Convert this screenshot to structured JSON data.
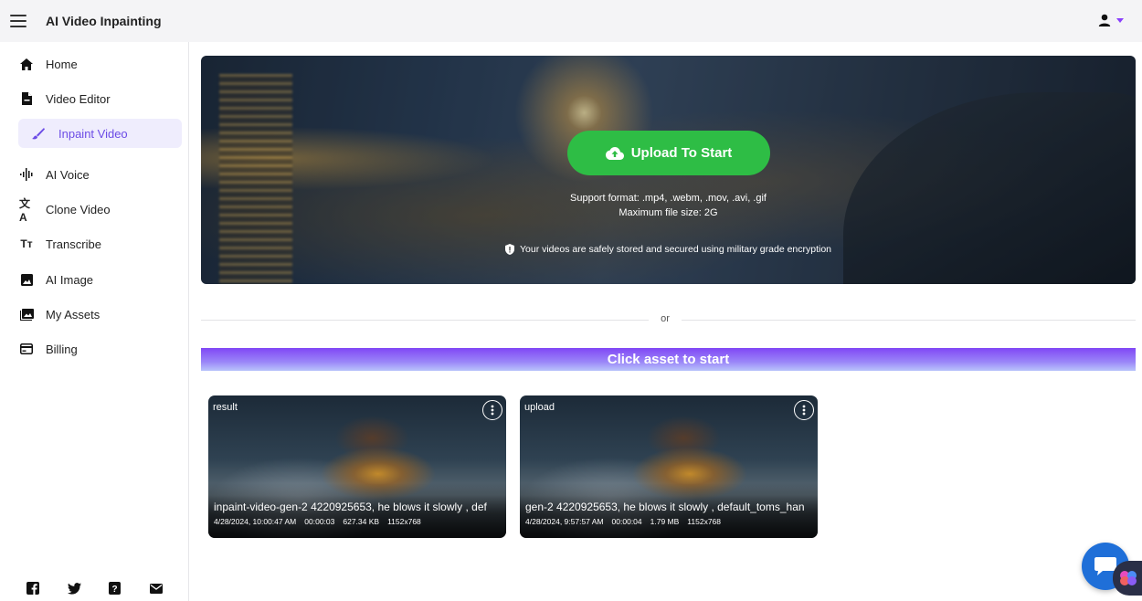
{
  "app": {
    "title": "AI Video Inpainting"
  },
  "sidebar": {
    "items": [
      {
        "label": "Home",
        "icon": "home-icon"
      },
      {
        "label": "Video Editor",
        "icon": "file-icon"
      },
      {
        "label": "Inpaint Video",
        "icon": "brush-icon",
        "active": true
      },
      {
        "label": "AI Voice",
        "icon": "waveform-icon"
      },
      {
        "label": "Clone Video",
        "icon": "translate-icon"
      },
      {
        "label": "Transcribe",
        "icon": "text-size-icon"
      },
      {
        "label": "AI Image",
        "icon": "image-icon"
      },
      {
        "label": "My Assets",
        "icon": "photo-library-icon"
      },
      {
        "label": "Billing",
        "icon": "credit-card-icon"
      }
    ],
    "social": [
      "facebook-icon",
      "twitter-icon",
      "help-icon",
      "mail-icon"
    ]
  },
  "hero": {
    "upload_label": "Upload To Start",
    "support_format": "Support format: .mp4, .webm, .mov, .avi, .gif",
    "max_size": "Maximum file size: 2G",
    "secure_note": "Your videos are safely stored and secured using military grade encryption"
  },
  "divider": {
    "text": "or"
  },
  "banner": {
    "text": "Click asset to start"
  },
  "assets": [
    {
      "tag": "result",
      "name": "inpaint-video-gen-2 4220925653, he blows it slowly , def",
      "date": "4/28/2024, 10:00:47 AM",
      "duration": "00:00:03",
      "size": "627.34 KB",
      "resolution": "1152x768"
    },
    {
      "tag": "upload",
      "name": "gen-2 4220925653, he blows it slowly , default_toms_han",
      "date": "4/28/2024, 9:57:57 AM",
      "duration": "00:00:04",
      "size": "1.79 MB",
      "resolution": "1152x768"
    }
  ],
  "colors": {
    "accent": "#6c4ce6",
    "upload_green": "#2ebd45",
    "chat_blue": "#1f6fd8"
  }
}
